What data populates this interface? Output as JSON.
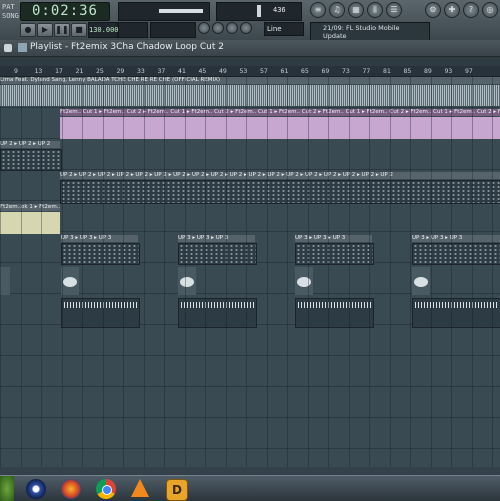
{
  "toolbar": {
    "time": "0:02:36",
    "pat_label": "PAT",
    "song_label": "SONG",
    "tempo": "130.000",
    "pattern_num": "436",
    "snap": "Line",
    "news_line1": "21/09: FL Studio Mobile",
    "news_line2": "Update",
    "icons": [
      "playlist-icon",
      "piano-roll-icon",
      "step-sequencer-icon",
      "mixer-icon",
      "browser-icon",
      "channel-settings-icon",
      "plugin-icon",
      "help-icon",
      "cpu-icon"
    ]
  },
  "playlist": {
    "title": "Playlist - Ft2emix 3Cha Chadow Loop Cut 2",
    "ruler_ticks": [
      "9",
      "13",
      "17",
      "21",
      "25",
      "29",
      "33",
      "37",
      "41",
      "45",
      "49",
      "53",
      "57",
      "61",
      "65",
      "69",
      "73",
      "77",
      "81",
      "85",
      "89",
      "93",
      "97"
    ],
    "track1_label": "Lima Feat. Dyland Sang, Lenny BALADA TCHE CHE RE RE CHE (OFFICIAL REMIX)",
    "clip_cut_label": "Ft2em.. Cut 1 ▸ Ft2em.. Cut 2 ▸ Ft2em.. Cut 1 ▸ Ft2em.. Cut 2 ▸ Ft2em.. Cut 1 ▸ Ft2em.. Cut 2 ▸ Ft2em.. Cut 1 ▸ Ft2em.. Cut 2 ▸ Ft2em.. Cut 1 ▸ Ft2em.. Cut 2 ▸ Ft2em.. Cut 1",
    "up_label_short": "UP 2 ▸ UP 2 ▸ UP 2",
    "up_label_long": "UP 2 ▸ UP 2 ▸ UP 2 ▸ UP 2 ▸ UP 2 ▸ UP 2 ▸ UP 2 ▸ UP 2 ▸ UP 2 ▸ UP 2 ▸ UP 2 ▸ UP 2 ▸ UP 2 ▸ UP 2 ▸ UP 2 ▸ UP 2 ▸ UP 2 ▸ UP 2",
    "small_cut_label": "Ft2em..ok 1 ▸ Ft2em..ok 1",
    "up3_label": "UP 3 ▸ UP 3 ▸ UP 3"
  },
  "taskbar": {
    "icons": [
      "start-orb-icon",
      "media-icon",
      "firefox-icon",
      "chrome-icon",
      "vlc-icon",
      "fl-studio-icon"
    ]
  }
}
